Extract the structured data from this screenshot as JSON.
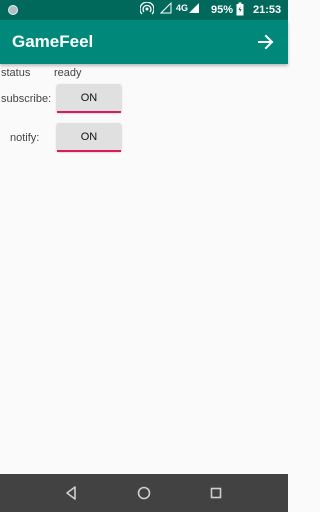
{
  "status_bar": {
    "network": "4G",
    "battery": "95%",
    "time": "21:53"
  },
  "app_bar": {
    "title": "GameFeel",
    "action_icon": "arrow-forward-icon"
  },
  "form": {
    "status_label": "status",
    "status_value": "ready",
    "subscribe_label": "subscribe:",
    "subscribe_button": "ON",
    "notify_label": "notify:",
    "notify_button": "ON"
  },
  "colors": {
    "status_bar": "#00695c",
    "app_bar": "#00897b",
    "accent_underline": "#d81b60",
    "nav_bar": "#424242"
  },
  "nav_bar": {
    "back_icon": "back-triangle-icon",
    "home_icon": "home-circle-icon",
    "recents_icon": "recents-square-icon"
  }
}
